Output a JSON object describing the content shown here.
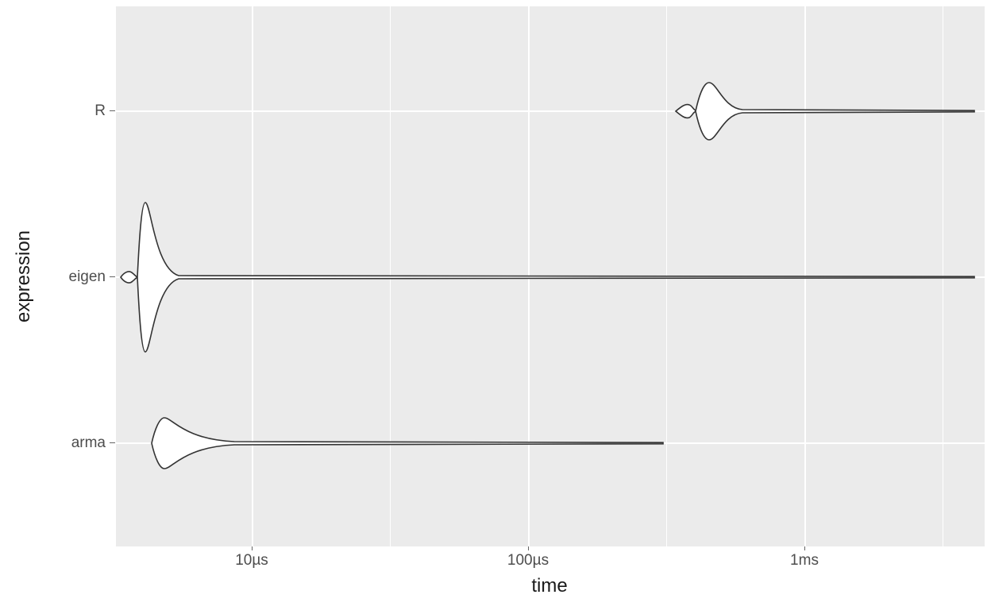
{
  "chart_data": {
    "type": "violin",
    "xlabel": "time",
    "ylabel": "expression",
    "x_scale": "log10",
    "x_ticks": [
      {
        "label": "10µs",
        "value_us": 10
      },
      {
        "label": "100µs",
        "value_us": 100
      },
      {
        "label": "1ms",
        "value_us": 1000
      }
    ],
    "y_categories": [
      "arma",
      "eigen",
      "R"
    ],
    "series": [
      {
        "name": "R",
        "median_us": 450,
        "min_us": 350,
        "max_us": 4200,
        "peak_mode_us": 440,
        "relative_peak_height": 0.35
      },
      {
        "name": "eigen",
        "median_us": 4.0,
        "min_us": 3.3,
        "max_us": 4200,
        "peak_mode_us": 4.0,
        "relative_peak_height": 1.0
      },
      {
        "name": "arma",
        "median_us": 5.3,
        "min_us": 4.6,
        "max_us": 600,
        "peak_mode_us": 5.2,
        "relative_peak_height": 0.32
      }
    ],
    "ylim_categories": [
      "arma",
      "eigen",
      "R"
    ]
  },
  "axis": {
    "x_label": "time",
    "y_label": "expression",
    "x_tick_0": "10µs",
    "x_tick_1": "100µs",
    "x_tick_2": "1ms"
  },
  "cats": {
    "c0": "arma",
    "c1": "eigen",
    "c2": "R"
  }
}
